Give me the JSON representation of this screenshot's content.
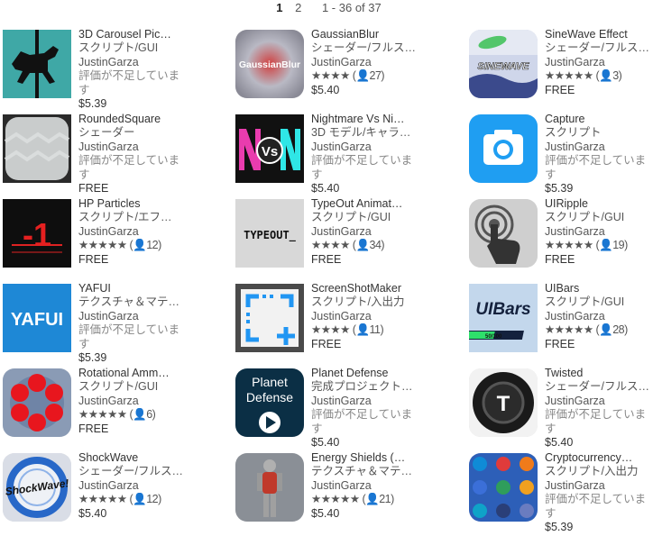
{
  "pagination": {
    "pages": [
      "1",
      "2"
    ],
    "current": "1",
    "range": "1 - 36 of 37"
  },
  "items": [
    {
      "title": "3D Carousel Pic…",
      "category": "スクリプト/GUI",
      "publisher": "JustinGarza",
      "rating": "",
      "note": "評価が不足しています",
      "price": "$5.39",
      "icon": "carousel-horse-icon"
    },
    {
      "title": "GaussianBlur",
      "category": "シェーダー/フルス…",
      "publisher": "JustinGarza",
      "rating": "★★★★ (👤27)",
      "note": "",
      "price": "$5.40",
      "icon": "gaussian-blur-icon",
      "icon_text": "GaussianBlur"
    },
    {
      "title": "SineWave Effect",
      "category": "シェーダー/フルス…",
      "publisher": "JustinGarza",
      "rating": "★★★★★ (👤3)",
      "note": "",
      "price": "FREE",
      "icon": "sinewave-icon",
      "icon_text": "SINEWAVE"
    },
    {
      "title": "RoundedSquare",
      "category": "シェーダー",
      "publisher": "JustinGarza",
      "rating": "",
      "note": "評価が不足しています",
      "price": "FREE",
      "icon": "rounded-square-icon"
    },
    {
      "title": "Nightmare Vs Ni…",
      "category": "3D モデル/キャラ…",
      "publisher": "JustinGarza",
      "rating": "",
      "note": "評価が不足しています",
      "price": "$5.40",
      "icon": "nightmare-vs-icon",
      "icon_text": "Vs"
    },
    {
      "title": "Capture",
      "category": "スクリプト",
      "publisher": "JustinGarza",
      "rating": "",
      "note": "評価が不足しています",
      "price": "$5.39",
      "icon": "camera-icon"
    },
    {
      "title": "HP Particles",
      "category": "スクリプト/エフ…",
      "publisher": "JustinGarza",
      "rating": "★★★★★ (👤12)",
      "note": "",
      "price": "FREE",
      "icon": "hp-particles-icon",
      "icon_text": "-1"
    },
    {
      "title": "TypeOut Animat…",
      "category": "スクリプト/GUI",
      "publisher": "JustinGarza",
      "rating": "★★★★ (👤34)",
      "note": "",
      "price": "FREE",
      "icon": "typeout-icon",
      "icon_text": "TYPEOUT_"
    },
    {
      "title": "UIRipple",
      "category": "スクリプト/GUI",
      "publisher": "JustinGarza",
      "rating": "★★★★★ (👤19)",
      "note": "",
      "price": "FREE",
      "icon": "touch-ripple-icon"
    },
    {
      "title": "YAFUI",
      "category": "テクスチャ＆マテ…",
      "publisher": "JustinGarza",
      "rating": "",
      "note": "評価が不足しています",
      "price": "$5.39",
      "icon": "yafui-icon",
      "icon_text": "YAFUI"
    },
    {
      "title": "ScreenShotMaker",
      "category": "スクリプト/入出力",
      "publisher": "JustinGarza",
      "rating": "★★★★ (👤11)",
      "note": "",
      "price": "FREE",
      "icon": "screenshot-icon"
    },
    {
      "title": "UIBars",
      "category": "スクリプト/GUI",
      "publisher": "JustinGarza",
      "rating": "★★★★★ (👤28)",
      "note": "",
      "price": "FREE",
      "icon": "uibars-icon",
      "icon_text": "UIBars",
      "icon_subtext": "50/100"
    },
    {
      "title": "Rotational Amm…",
      "category": "スクリプト/GUI",
      "publisher": "JustinGarza",
      "rating": "★★★★★ (👤6)",
      "note": "",
      "price": "FREE",
      "icon": "rotational-ammo-icon"
    },
    {
      "title": "Planet Defense",
      "category": "完成プロジェクト…",
      "publisher": "JustinGarza",
      "rating": "",
      "note": "評価が不足しています",
      "price": "$5.40",
      "icon": "planet-defense-icon",
      "icon_text": "Planet",
      "icon_subtext": "Defense"
    },
    {
      "title": "Twisted",
      "category": "シェーダー/フルス…",
      "publisher": "JustinGarza",
      "rating": "",
      "note": "評価が不足しています",
      "price": "$5.40",
      "icon": "twisted-icon",
      "icon_text": "T"
    },
    {
      "title": "ShockWave",
      "category": "シェーダー/フルス…",
      "publisher": "JustinGarza",
      "rating": "★★★★★ (👤12)",
      "note": "",
      "price": "$5.40",
      "icon": "shockwave-icon",
      "icon_text": "ShockWave!"
    },
    {
      "title": "Energy Shields (…",
      "category": "テクスチャ＆マテ…",
      "publisher": "JustinGarza",
      "rating": "★★★★★ (👤21)",
      "note": "",
      "price": "$5.40",
      "icon": "energy-shields-icon"
    },
    {
      "title": "Cryptocurrency…",
      "category": "スクリプト/入出力",
      "publisher": "JustinGarza",
      "rating": "",
      "note": "評価が不足しています",
      "price": "$5.39",
      "icon": "cryptocurrency-icon"
    }
  ]
}
